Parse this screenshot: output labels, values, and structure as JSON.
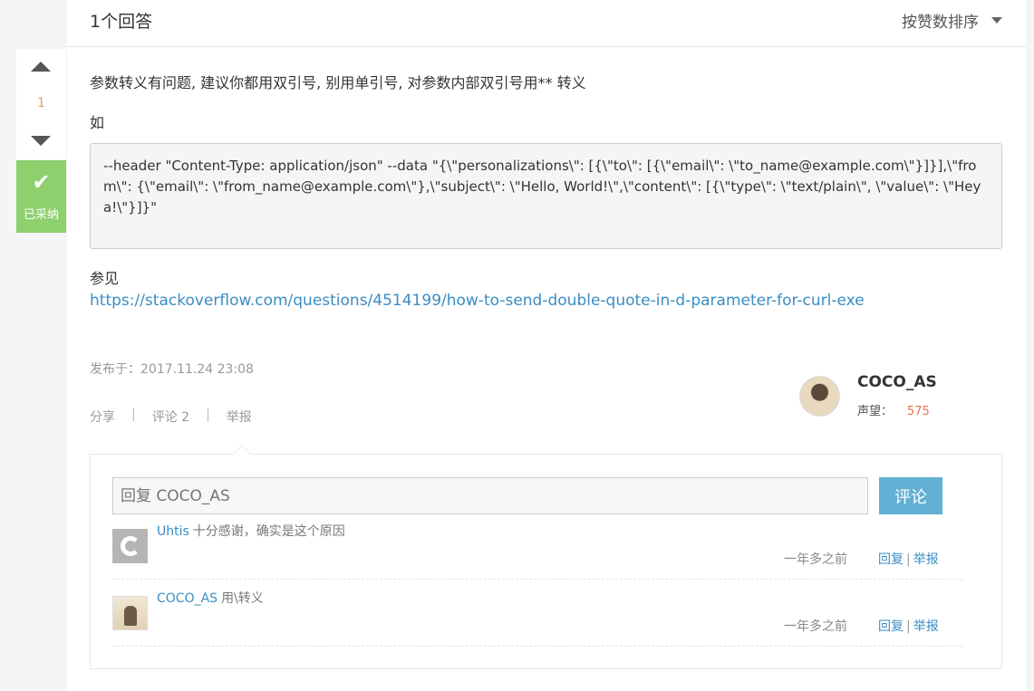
{
  "header": {
    "answer_count": "1个回答",
    "sort_label": "按赞数排序"
  },
  "vote": {
    "count": "1",
    "accepted_label": "已采纳",
    "accepted_icon": "check-icon"
  },
  "answer": {
    "line1": "参数转义有问题, 建议你都用双引号, 别用单引号, 对参数内部双引号用** 转义",
    "line2": "如",
    "code": "--header \"Content-Type: application/json\" --data \"{\\\"personalizations\\\": [{\\\"to\\\": [{\\\"email\\\": \\\"to_name@example.com\\\"}]}],\\\"from\\\": {\\\"email\\\": \\\"from_name@example.com\\\"},\\\"subject\\\": \\\"Hello, World!\\\",\\\"content\\\": [{\\\"type\\\": \\\"text/plain\\\", \\\"value\\\": \\\"Heya!\\\"}]}\"",
    "see_also": "参见",
    "link": "https://stackoverflow.com/questions/4514199/how-to-send-double-quote-in-d-parameter-for-curl-exe"
  },
  "meta": {
    "published": "发布于：2017.11.24 23:08"
  },
  "actions": {
    "share": "分享",
    "comment": "评论 2",
    "report": "举报",
    "separator": "|"
  },
  "author": {
    "name": "COCO_AS",
    "rep_label": "声望：",
    "rep_value": "575"
  },
  "reply": {
    "placeholder": "回复 COCO_AS",
    "button": "评论"
  },
  "comments": [
    {
      "user": "Uhtis",
      "text": "十分感谢，确实是这个原因",
      "time": "一年多之前",
      "reply": "回复",
      "report": "举报"
    },
    {
      "user": "COCO_AS",
      "text": "用\\转义",
      "time": "一年多之前",
      "reply": "回复",
      "report": "举报"
    }
  ],
  "colors": {
    "accent": "#3a8dc3",
    "accepted": "#8ed06e",
    "reputation": "#e8704d",
    "vote": "#e6a057",
    "button": "#62b0d3"
  }
}
